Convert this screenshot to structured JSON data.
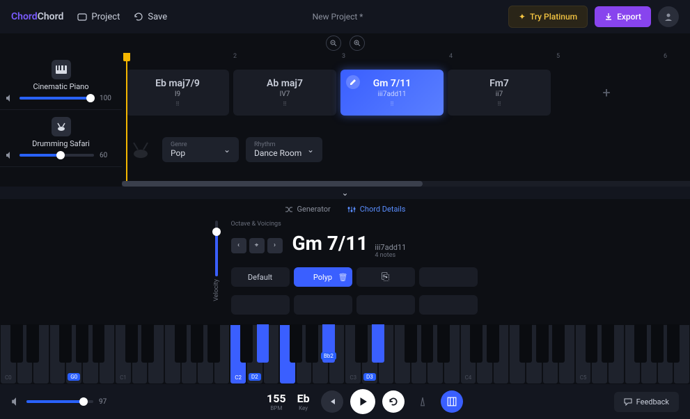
{
  "header": {
    "logo_1": "Chord",
    "logo_2": "Chord",
    "project_btn": "Project",
    "save_btn": "Save",
    "project_name": "New Project *",
    "try_platinum": "Try Platinum",
    "export": "Export"
  },
  "tracks": [
    {
      "name": "Cinematic Piano",
      "volume": 100,
      "volume_pct": 95
    },
    {
      "name": "Drumming Safari",
      "volume": 60,
      "volume_pct": 55
    }
  ],
  "ruler": [
    "2",
    "3",
    "4",
    "5",
    "6"
  ],
  "chords": [
    {
      "name": "Eb maj7/9",
      "roman": "I9",
      "active": false
    },
    {
      "name": "Ab maj7",
      "roman": "IV7",
      "active": false
    },
    {
      "name": "Gm 7/11",
      "roman": "iii7add11",
      "active": true
    },
    {
      "name": "Fm7",
      "roman": "ii7",
      "active": false
    }
  ],
  "rhythm": {
    "genre_label": "Genre",
    "genre_value": "Pop",
    "rhythm_label": "Rhythm",
    "rhythm_value": "Dance Room"
  },
  "detail": {
    "tab_generator": "Generator",
    "tab_details": "Chord Details",
    "ov_label": "Octave & Voicings",
    "velocity_label": "Velocity",
    "velocity_pct": 85,
    "chord_name": "Gm 7/11",
    "chord_sub": "iii7add11",
    "chord_notes": "4 notes",
    "voicings": [
      "Default",
      "Polyp"
    ],
    "voicing_active_idx": 1
  },
  "piano": {
    "octaves": [
      "C0",
      "C1",
      "C2",
      "C3",
      "C4",
      "C5"
    ],
    "highlighted_white": [
      "C2",
      "F2"
    ],
    "highlighted_black": [
      "D2",
      "D3"
    ],
    "note_badges": {
      "G0": "G0",
      "D2": "D2",
      "Bb2": "Bb2",
      "D3": "D3"
    }
  },
  "bottom": {
    "master_vol_pct": 85,
    "master_vol": 97,
    "bpm": 155,
    "bpm_label": "BPM",
    "key": "Eb",
    "key_label": "Key",
    "feedback": "Feedback"
  }
}
